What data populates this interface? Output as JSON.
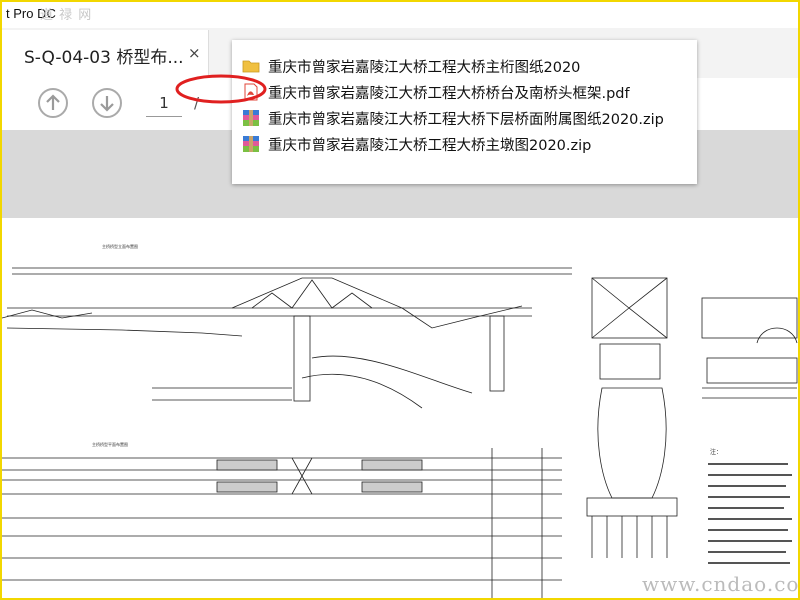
{
  "app": {
    "title_fragment": "t Pro DC",
    "watermark_top": "道 禄 网"
  },
  "tab": {
    "title": "S-Q-04-03 桥型布...",
    "close_glyph": "×"
  },
  "toolbar": {
    "prev_page_icon": "arrow-up-circle-icon",
    "next_page_icon": "arrow-down-circle-icon",
    "current_page": "1",
    "page_separator": "/"
  },
  "dropdown": {
    "items": [
      {
        "label": "重庆市曾家岩嘉陵江大桥工程大桥主桁图纸2020",
        "icon": "folder-icon",
        "color": "#f0c040"
      },
      {
        "label": "重庆市曾家岩嘉陵江大桥工程大桥桥台及南桥头框架.pdf",
        "icon": "pdf-icon",
        "color": "#e0453a"
      },
      {
        "label": "重庆市曾家岩嘉陵江大桥工程大桥下层桥面附属图纸2020.zip",
        "icon": "zip-archive-icon",
        "color": "#3a7bd5"
      },
      {
        "label": "重庆市曾家岩嘉陵江大桥工程大桥主墩图2020.zip",
        "icon": "zip-archive-icon",
        "color": "#3a7bd5"
      }
    ]
  },
  "drawing": {
    "label_elevation": "主桥桥型立面布置图",
    "label_plan": "主桥桥型平面布置图",
    "notes_heading": "注："
  },
  "watermark_bottom": "www.cndao.com",
  "colors": {
    "frame_border": "#f2d700",
    "annotation_red": "#e02020",
    "gray_band": "#d9d9d9"
  }
}
